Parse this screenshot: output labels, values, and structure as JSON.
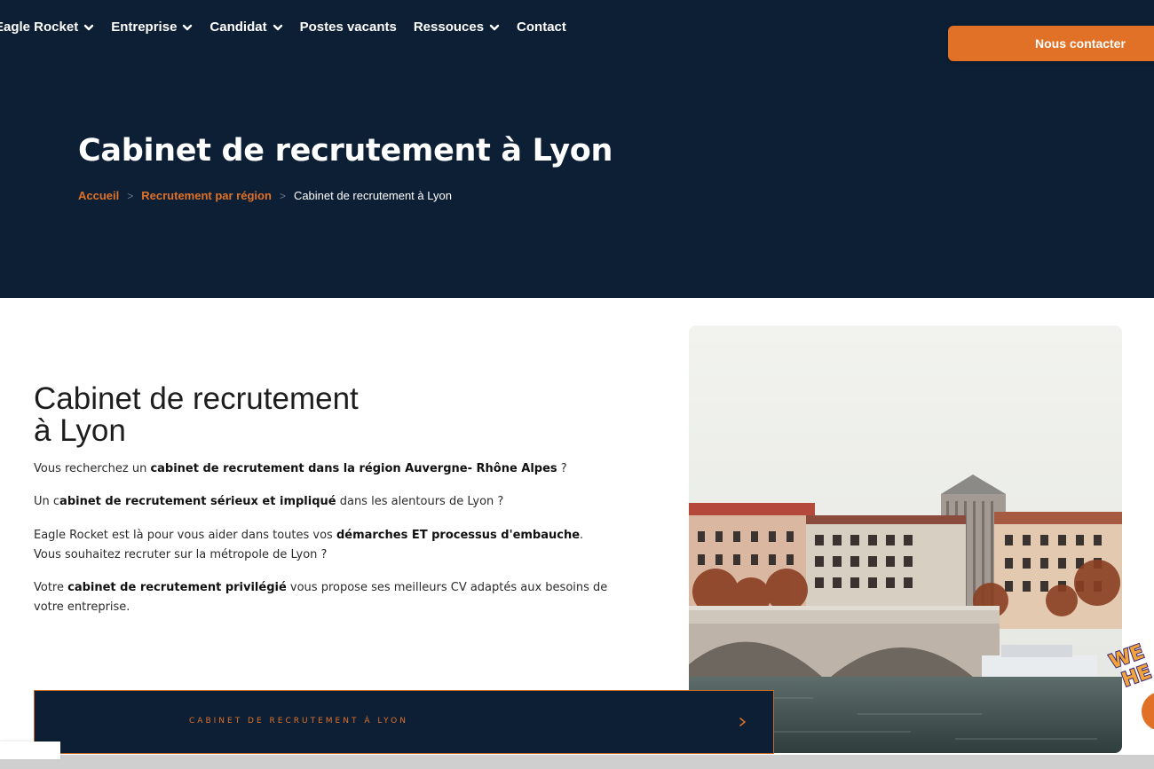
{
  "nav": {
    "items": [
      {
        "label": "Eagle Rocket",
        "dropdown": true
      },
      {
        "label": "Entreprise",
        "dropdown": true
      },
      {
        "label": "Candidat",
        "dropdown": true
      },
      {
        "label": "Postes vacants",
        "dropdown": false
      },
      {
        "label": "Ressouces",
        "dropdown": true
      },
      {
        "label": "Contact",
        "dropdown": false
      }
    ],
    "cta_label": "Nous contacter"
  },
  "hero": {
    "title": "Cabinet de recrutement à Lyon",
    "breadcrumb": {
      "home": "Accueil",
      "section": "Recrutement par région",
      "current": "Cabinet de recrutement à Lyon",
      "separator": ">"
    }
  },
  "content": {
    "heading_line1": "Cabinet de recrutement",
    "heading_line2": "à Lyon",
    "p1": {
      "a": "Vous recherchez un ",
      "b": "cabinet de recrutement dans la région Auvergne- Rhône Alpes",
      "c": " ?"
    },
    "p2": {
      "a": "Un c",
      "b": "abinet de recrutement sérieux et impliqué",
      "c": " dans les alentours de Lyon ?"
    },
    "p3": {
      "a": "Eagle Rocket est là pour vous aider dans toutes vos ",
      "b": "démarches ET processus d'embauche",
      "c": ".",
      "d": "Vous souhaitez recruter sur la métropole de Lyon ?"
    },
    "p4": {
      "a": "Votre ",
      "b": "cabinet de recrutement privilégié",
      "c": " vous propose ses meilleurs CV adaptés aux besoins de votre entreprise."
    }
  },
  "accordion": {
    "label": "CABINET DE RECRUTEMENT À LYON",
    "arrow": "›"
  },
  "colors": {
    "navy": "#0c1f35",
    "orange": "#e07127"
  },
  "icons": [
    "chevron-down-icon",
    "chevron-right-icon"
  ]
}
